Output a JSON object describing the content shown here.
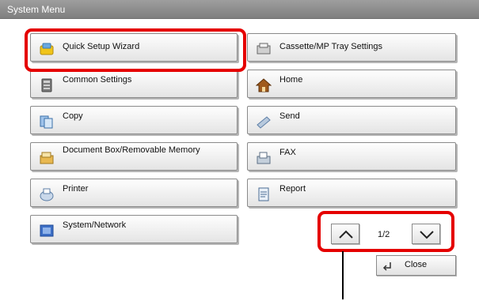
{
  "window": {
    "title": "System Menu"
  },
  "menu": {
    "left": [
      {
        "label": "Quick Setup Wizard",
        "icon": "wizard-icon"
      },
      {
        "label": "Common Settings",
        "icon": "common-settings-icon"
      },
      {
        "label": "Copy",
        "icon": "copy-icon"
      },
      {
        "label": "Document Box/Removable Memory",
        "icon": "document-box-icon"
      },
      {
        "label": "Printer",
        "icon": "printer-icon"
      },
      {
        "label": "System/Network",
        "icon": "system-network-icon"
      }
    ],
    "right": [
      {
        "label": "Cassette/MP Tray Settings",
        "icon": "cassette-icon"
      },
      {
        "label": "Home",
        "icon": "home-icon"
      },
      {
        "label": "Send",
        "icon": "send-icon"
      },
      {
        "label": "FAX",
        "icon": "fax-icon"
      },
      {
        "label": "Report",
        "icon": "report-icon"
      }
    ]
  },
  "pager": {
    "indicator": "1/2",
    "up_icon": "chevron-up-icon",
    "down_icon": "chevron-down-icon"
  },
  "close": {
    "label": "Close",
    "icon": "return-arrow-icon"
  },
  "colors": {
    "highlight": "#e50000",
    "title_bar": "#8a8a8a"
  }
}
